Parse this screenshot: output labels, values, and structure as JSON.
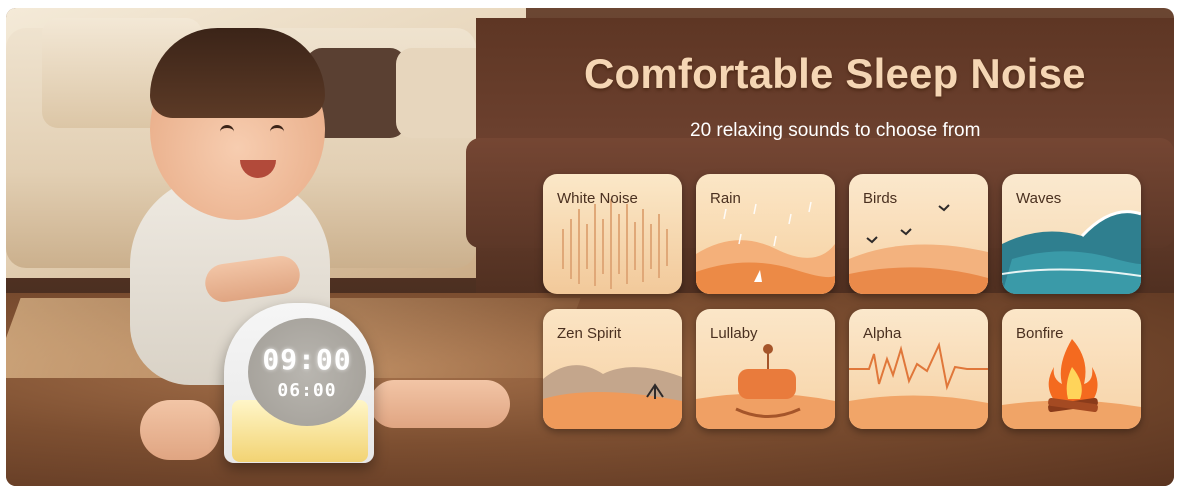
{
  "banner": {
    "title": "Comfortable Sleep Noise",
    "subtitle": "20 relaxing sounds to choose from"
  },
  "clock": {
    "time": "09:00",
    "alarm": "06:00"
  },
  "tiles": [
    {
      "label": "White Noise",
      "icon": "white-noise-icon"
    },
    {
      "label": "Rain",
      "icon": "rain-icon"
    },
    {
      "label": "Birds",
      "icon": "birds-icon"
    },
    {
      "label": "Waves",
      "icon": "waves-icon"
    },
    {
      "label": "Zen Spirit",
      "icon": "zen-spirit-icon"
    },
    {
      "label": "Lullaby",
      "icon": "lullaby-icon"
    },
    {
      "label": "Alpha",
      "icon": "alpha-icon"
    },
    {
      "label": "Bonfire",
      "icon": "bonfire-icon"
    }
  ],
  "colors": {
    "title": "#f5d6b4",
    "subtitle": "#ffffff",
    "tile_top": "#fbe9cf",
    "tile_bottom": "#f08a3c"
  }
}
